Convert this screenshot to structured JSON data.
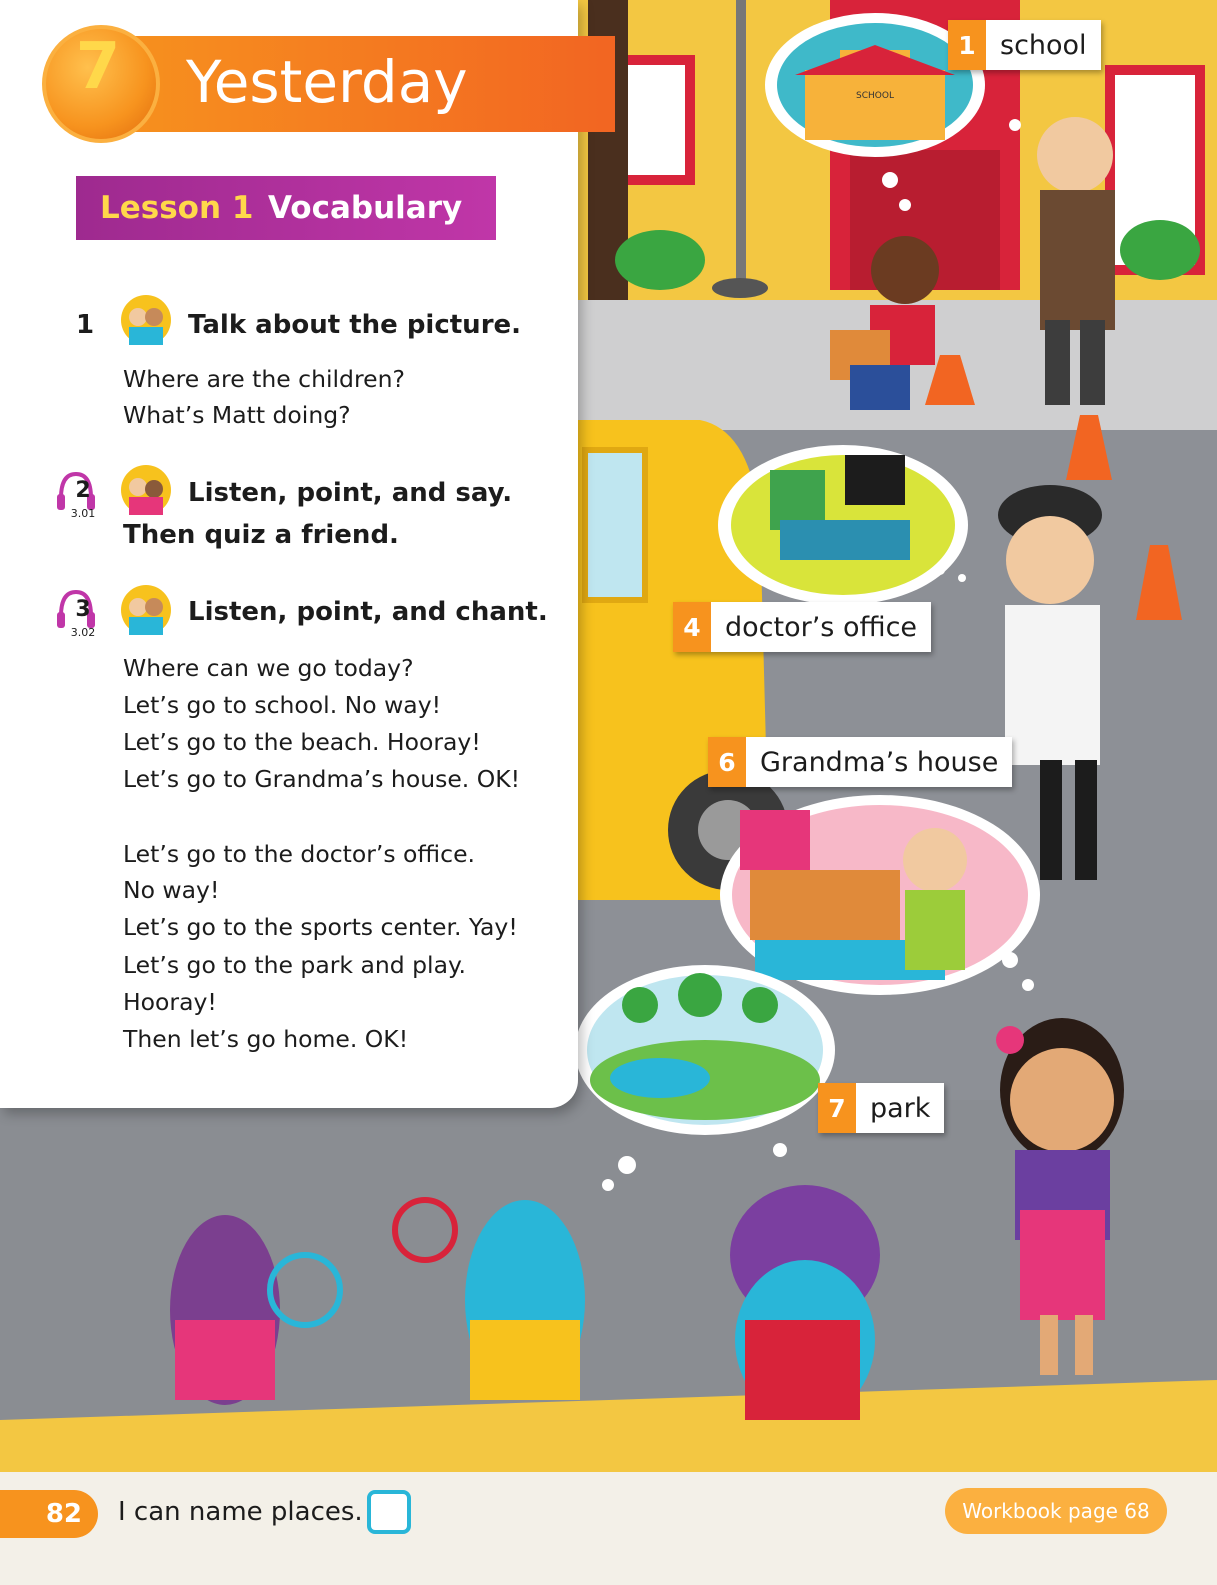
{
  "unit": {
    "number": "7",
    "title": "Yesterday"
  },
  "lesson": {
    "label": "Lesson 1",
    "name": "Vocabulary"
  },
  "exercises": [
    {
      "number": "1",
      "title": "Talk about the picture.",
      "lines": [
        "Where are the children?",
        "What’s Matt doing?"
      ]
    },
    {
      "number": "2",
      "track": "3.01",
      "title_line1": "Listen, point, and say.",
      "title_line2": "Then quiz a friend."
    },
    {
      "number": "3",
      "track": "3.02",
      "title": "Listen, point, and chant.",
      "lines": [
        "Where can we go today?",
        "Let’s go to school. No way!",
        "Let’s go to the beach. Hooray!",
        "Let’s go to Grandma’s house. OK!",
        "Let’s go to the doctor’s office.",
        "No way!",
        "Let’s go to the sports center. Yay!",
        "Let’s go to the park and play.",
        "Hooray!",
        "Then let’s go home. OK!"
      ]
    }
  ],
  "labels": [
    {
      "number": "1",
      "word": "school"
    },
    {
      "number": "4",
      "word": "doctor’s office"
    },
    {
      "number": "6",
      "word": "Grandma’s house"
    },
    {
      "number": "7",
      "word": "park"
    }
  ],
  "school_sign": "SCHOOL",
  "footer": {
    "page": "82",
    "can_do": "I can name places.",
    "workbook": "Workbook page 68"
  },
  "colors": {
    "orange": "#f7931e",
    "magenta": "#9e2a8f",
    "yellow": "#ffd84a",
    "teal": "#29b6d8"
  }
}
